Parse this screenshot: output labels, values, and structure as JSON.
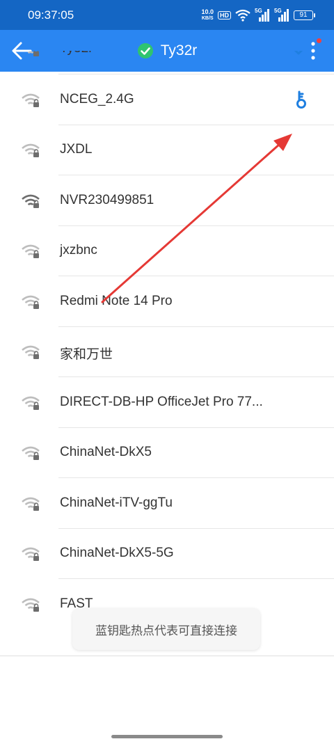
{
  "status_bar": {
    "time": "09:37:05",
    "speed_value": "10.0",
    "speed_unit": "KB/S",
    "hd_label": "HD",
    "sig1_label": "5G",
    "sig2_label": "5G",
    "battery": "91"
  },
  "app_bar": {
    "title": "Ty32r"
  },
  "networks": [
    {
      "name": "Ty32r",
      "status": "connected"
    },
    {
      "name": "NCEG_2.4G",
      "status": "key"
    },
    {
      "name": "JXDL",
      "status": ""
    },
    {
      "name": "NVR230499851",
      "status": ""
    },
    {
      "name": "jxzbnc",
      "status": ""
    },
    {
      "name": "Redmi Note 14 Pro",
      "status": ""
    },
    {
      "name": "家和万世",
      "status": ""
    },
    {
      "name": "DIRECT-DB-HP OfficeJet Pro 77...",
      "status": ""
    },
    {
      "name": "ChinaNet-DkX5",
      "status": ""
    },
    {
      "name": "ChinaNet-iTV-ggTu",
      "status": ""
    },
    {
      "name": "ChinaNet-DkX5-5G",
      "status": ""
    },
    {
      "name": "FAST_",
      "status": ""
    }
  ],
  "toast": {
    "text": "蓝钥匙热点代表可直接连接"
  },
  "colors": {
    "status_bar": "#1466c4",
    "app_bar": "#2a86f2",
    "connected_check": "#1a9e5a",
    "key_icon": "#1f7fe0",
    "annotation_arrow": "#e53935"
  }
}
